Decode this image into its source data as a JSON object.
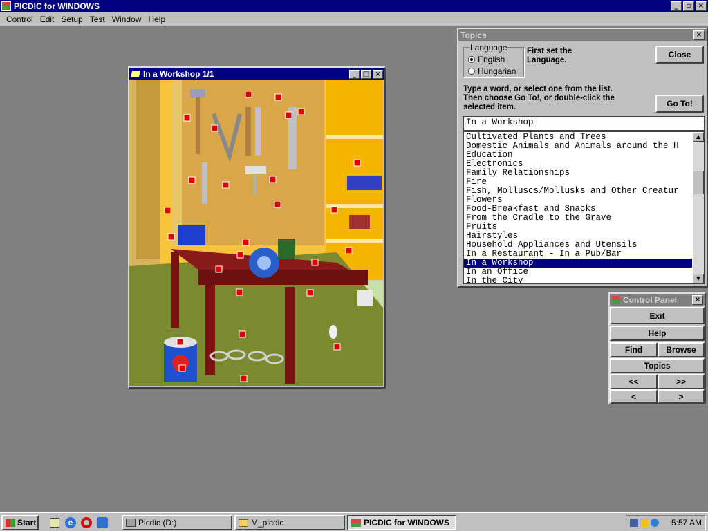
{
  "app": {
    "title": "PICDIC for WINDOWS"
  },
  "menu": [
    "Control",
    "Edit",
    "Setup",
    "Test",
    "Window",
    "Help"
  ],
  "picture_window": {
    "title": "In a Workshop 1/1"
  },
  "topics": {
    "title": "Topics",
    "language_label": "Language",
    "english": "English",
    "hungarian": "Hungarian",
    "selected_language": "English",
    "instruction1": "First set the Language.",
    "close": "Close",
    "instruction2": "Type a word, or select one from the list. Then choose Go To!, or double-click the selected item.",
    "goto": "Go To!",
    "input_value": "In a Workshop",
    "items": [
      "Cultivated Plants and Trees",
      "Domestic Animals and Animals around the H",
      "Education",
      "Electronics",
      "Family Relationships",
      "Fire",
      "Fish, Molluscs/Mollusks and Other Creatur",
      "Flowers",
      "Food-Breakfast and Snacks",
      "From the Cradle to the Grave",
      "Fruits",
      "Hairstyles",
      "Household Appliances and Utensils",
      "In a Restaurant - In a Pub/Bar",
      "In a Workshop",
      "In an Office",
      "In the City"
    ],
    "selected": "In a Workshop"
  },
  "control_panel": {
    "title": "Control Panel",
    "exit": "Exit",
    "help": "Help",
    "find": "Find",
    "browse": "Browse",
    "topics": "Topics",
    "first": "<<",
    "last": ">>",
    "prev": "<",
    "next": ">"
  },
  "taskbar": {
    "start": "Start",
    "tasks": [
      "Picdic (D:)",
      "M_picdic",
      "PICDIC for WINDOWS"
    ],
    "time": "5:57 AM"
  },
  "colors": {
    "title_bg": "#000080",
    "face": "#c0c0c0",
    "desktop": "#808080",
    "selection": "#000080",
    "hotspot": "#e00000"
  }
}
